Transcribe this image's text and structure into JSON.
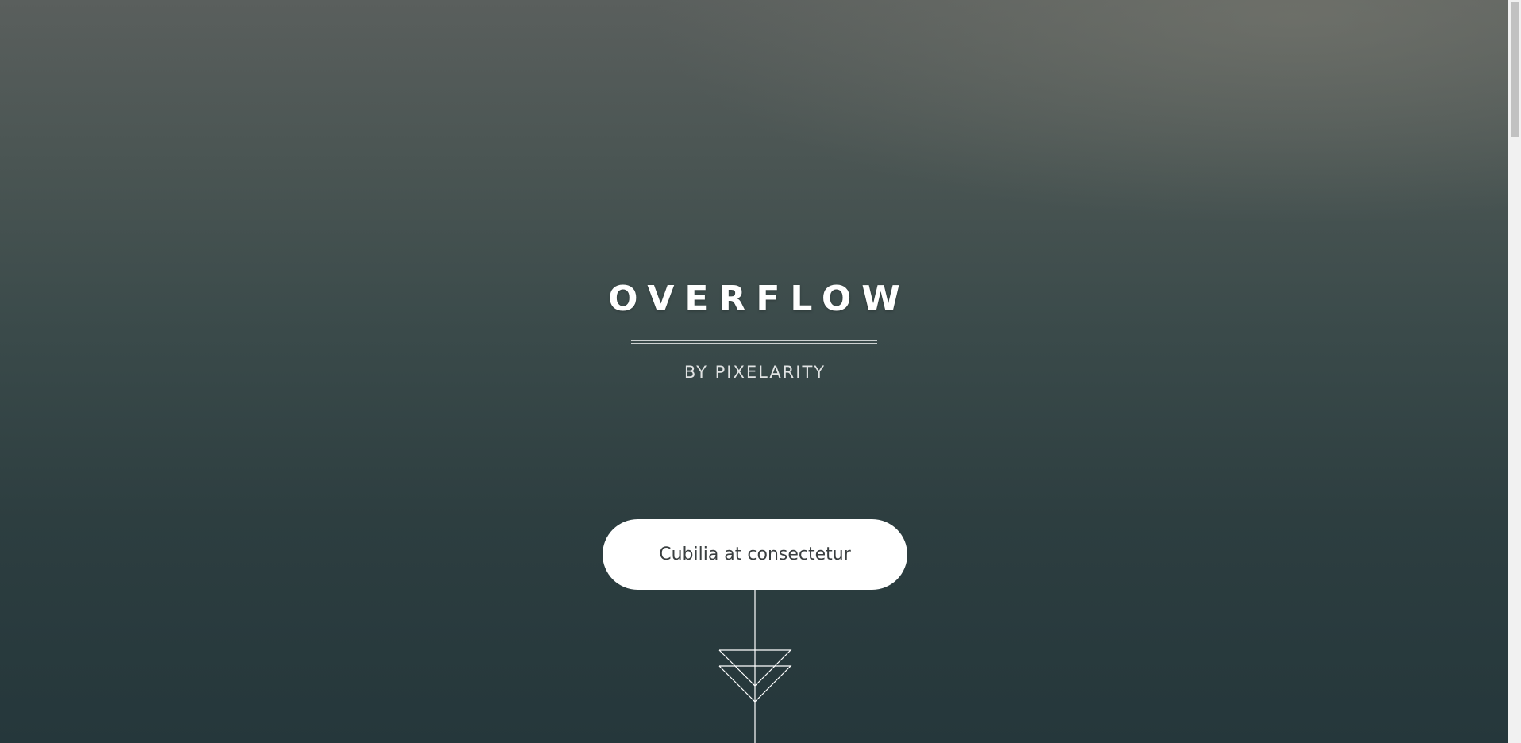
{
  "header": {
    "title": "OVERFLOW",
    "subtitle": "BY PIXELARITY"
  },
  "cta": {
    "label": "Cubilia at consectetur"
  },
  "decor": {
    "arrow_icon": "double-chevron-down-icon"
  },
  "colors": {
    "background_top": "#5a5f5d",
    "background_bottom": "#25373b",
    "button_bg": "#ffffff",
    "button_text": "#3a3f40",
    "title_text": "#ffffff"
  }
}
